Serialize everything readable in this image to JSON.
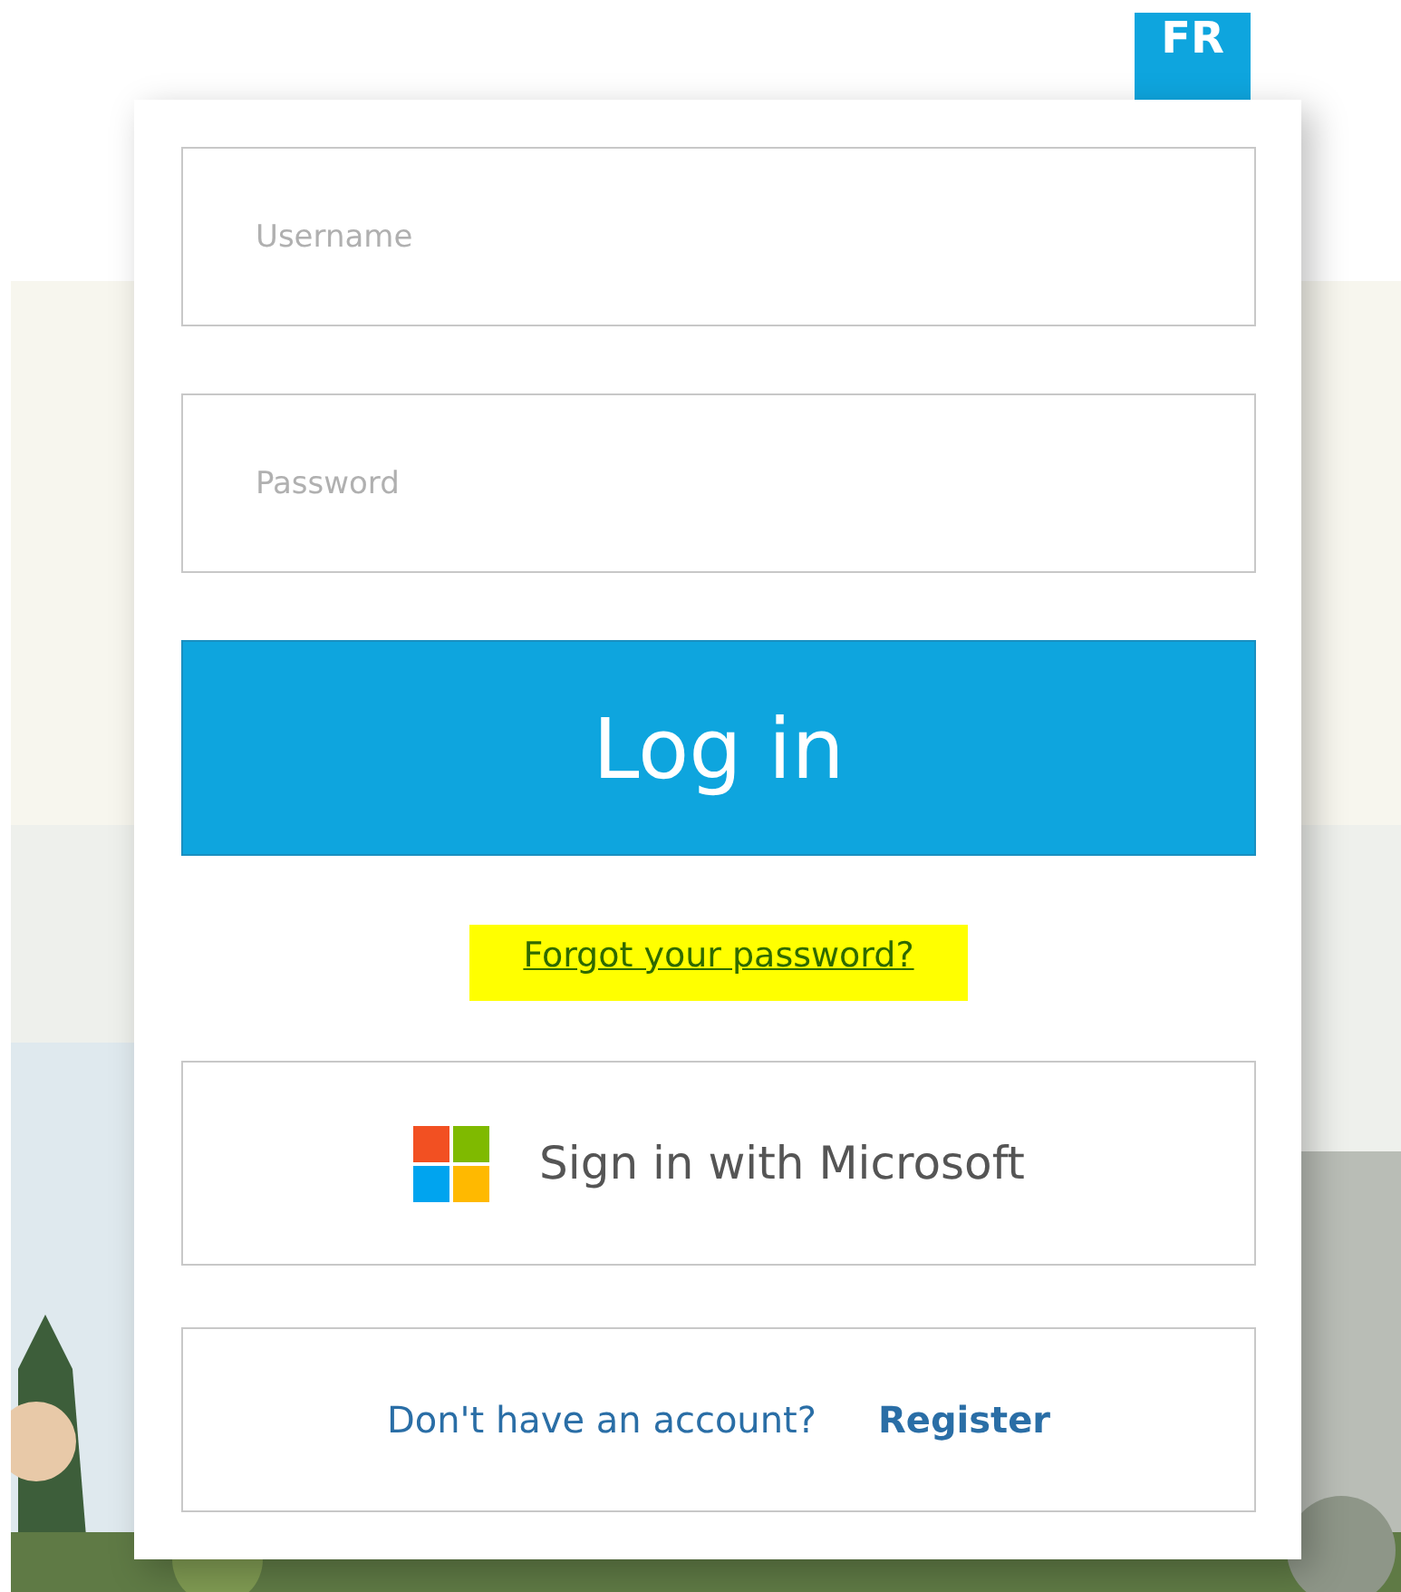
{
  "language_button": "FR",
  "username": {
    "placeholder": "Username"
  },
  "password": {
    "placeholder": "Password"
  },
  "login_button": "Log in",
  "forgot_link": {
    "text": "Forgot your password?",
    "highlighted": true
  },
  "microsoft_button": "Sign in with Microsoft",
  "register": {
    "prompt": "Don't have an account?",
    "link": "Register"
  }
}
